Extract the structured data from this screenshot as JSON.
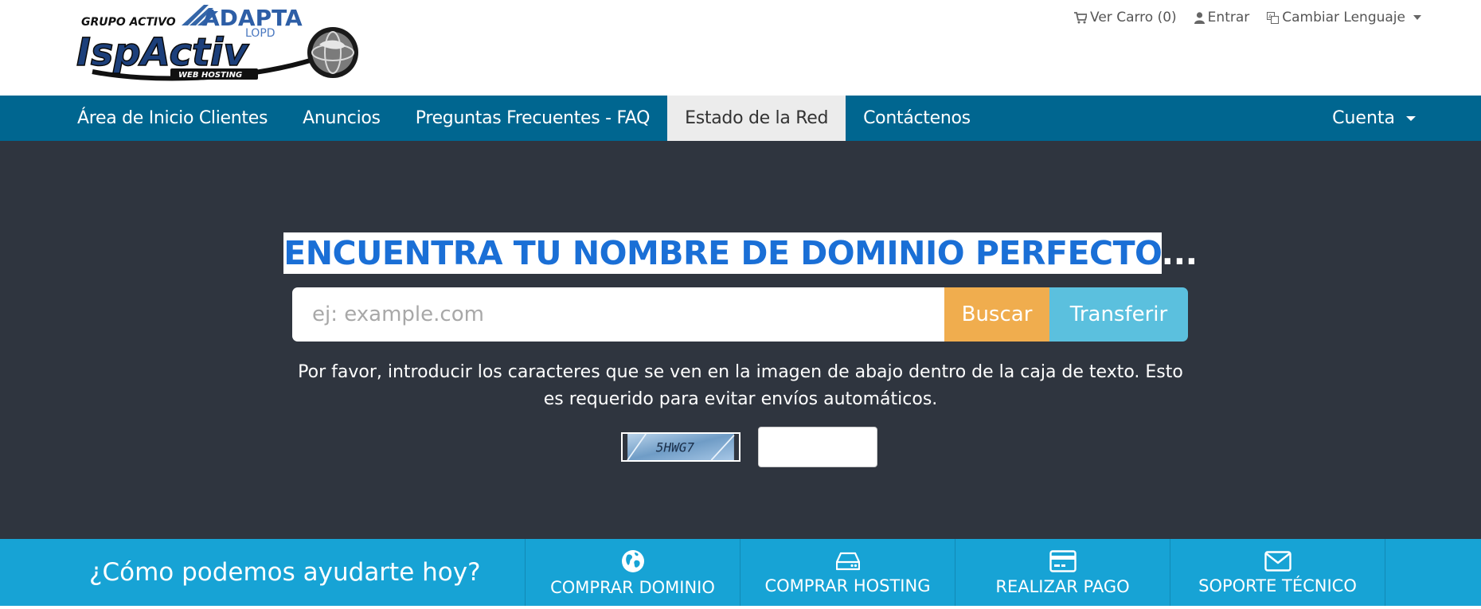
{
  "brand": {
    "logo_text_group": "GRUPO ACTIVO",
    "logo_text_adapta": "ADAPTA",
    "logo_text_lopd": "LOPD",
    "logo_text_main": "IspActiv",
    "logo_text_sub": "WEB HOSTING"
  },
  "top_links": {
    "cart": "Ver Carro (0)",
    "login": "Entrar",
    "language": "Cambiar Lenguaje"
  },
  "nav": {
    "items": [
      {
        "label": "Área de Inicio Clientes"
      },
      {
        "label": "Anuncios"
      },
      {
        "label": "Preguntas Frecuentes - FAQ"
      },
      {
        "label": "Estado de la Red"
      },
      {
        "label": "Contáctenos"
      }
    ],
    "account": "Cuenta"
  },
  "hero": {
    "title_highlight": "ENCUENTRA TU NOMBRE DE DOMINIO PERFECTO",
    "title_suffix": "...",
    "search_placeholder": "ej: example.com",
    "search_value": "",
    "search_button": "Buscar",
    "transfer_button": "Transferir",
    "captcha_instructions": "Por favor, introducir los caracteres que se ven en la imagen de abajo dentro de la caja de texto. Esto es requerido para evitar envíos automáticos.",
    "captcha_code": "5HWG7",
    "captcha_value": ""
  },
  "help": {
    "title": "¿Cómo podemos ayudarte hoy?",
    "items": [
      {
        "label": "COMPRAR DOMINIO",
        "icon": "globe-icon"
      },
      {
        "label": "COMPRAR HOSTING",
        "icon": "hard-drive-icon"
      },
      {
        "label": "REALIZAR PAGO",
        "icon": "credit-card-icon"
      },
      {
        "label": "SOPORTE TÉCNICO",
        "icon": "envelope-icon"
      }
    ]
  },
  "colors": {
    "nav_bg": "#006690",
    "hero_bg": "#2f353f",
    "title_blue": "#1a6fd6",
    "search_btn": "#f0ad4e",
    "transfer_btn": "#5bc0de",
    "help_bar": "#17a3d5"
  }
}
